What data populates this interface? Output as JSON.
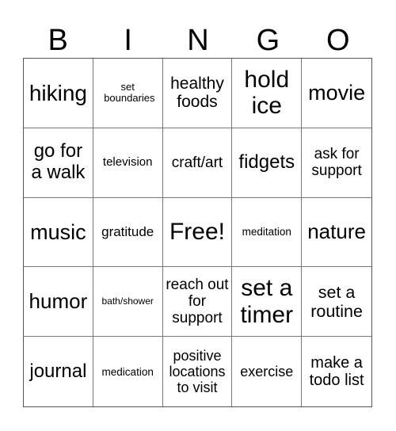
{
  "header": [
    "B",
    "I",
    "N",
    "G",
    "O"
  ],
  "cells": [
    {
      "text": "hiking",
      "size": 28
    },
    {
      "text": "set boundaries",
      "size": 13
    },
    {
      "text": "healthy foods",
      "size": 21
    },
    {
      "text": "hold ice",
      "size": 30
    },
    {
      "text": "movie",
      "size": 27
    },
    {
      "text": "go for a walk",
      "size": 24
    },
    {
      "text": "television",
      "size": 15
    },
    {
      "text": "craft/art",
      "size": 19
    },
    {
      "text": "fidgets",
      "size": 24
    },
    {
      "text": "ask for support",
      "size": 19
    },
    {
      "text": "music",
      "size": 27
    },
    {
      "text": "gratitude",
      "size": 17
    },
    {
      "text": "Free!",
      "size": 30
    },
    {
      "text": "meditation",
      "size": 13.5
    },
    {
      "text": "nature",
      "size": 26
    },
    {
      "text": "humor",
      "size": 26
    },
    {
      "text": "bath/shower",
      "size": 12
    },
    {
      "text": "reach out for support",
      "size": 19
    },
    {
      "text": "set a timer",
      "size": 30
    },
    {
      "text": "set a routine",
      "size": 21.5
    },
    {
      "text": "journal",
      "size": 24
    },
    {
      "text": "medication",
      "size": 13.5
    },
    {
      "text": "positive locations to visit",
      "size": 18
    },
    {
      "text": "exercise",
      "size": 18
    },
    {
      "text": "make a todo list",
      "size": 20
    }
  ]
}
